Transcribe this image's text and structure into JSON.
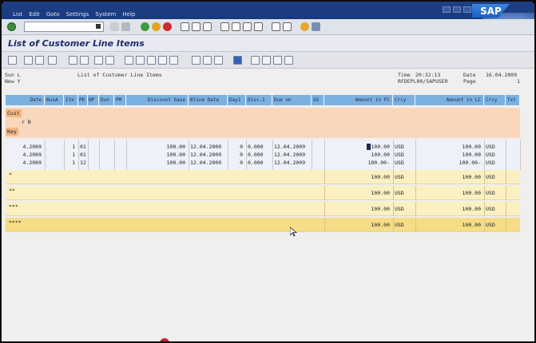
{
  "menubar": {
    "items": [
      "List",
      "Edit",
      "Goto",
      "Settings",
      "System",
      "Help"
    ],
    "logo": "SAP"
  },
  "titlebar": {
    "title": "List of Customer Line Items"
  },
  "report_header": {
    "left_line1": "Sun L",
    "left_line2": "New Y",
    "center": "List of Customer Line Items",
    "time_label": "Time",
    "time": "20:32:13",
    "date_label": "Date",
    "date": "16.04.2009",
    "program": "RFDEPL00/SAPUSER",
    "page_label": "Page",
    "page": "1"
  },
  "columns": [
    "Date",
    "BusA",
    "Ite",
    "PK",
    "NP",
    "Dun",
    "PM",
    "Discount base",
    "Bline Date",
    "Day1",
    "Disc.1",
    "Due on",
    "SG",
    "Amount in FC",
    "Crcy",
    "Amount in LC",
    "Crcy",
    "Txt"
  ],
  "group_header": {
    "line1": "Cust",
    "line2": "r B",
    "line3": "Key"
  },
  "rows": [
    {
      "date": "4.2009",
      "ite": "1",
      "pk": "01",
      "disc_base": "100.00",
      "bline": "12.04.2009",
      "day1": "0",
      "disc1": "0.000",
      "due": "12.04.2009",
      "amt_fc": "100.00",
      "crcy": "USD",
      "amt_lc": "100.00",
      "crcy2": "USD"
    },
    {
      "date": "4.2009",
      "ite": "1",
      "pk": "01",
      "disc_base": "100.00",
      "bline": "12.04.2009",
      "day1": "0",
      "disc1": "0.000",
      "due": "12.04.2009",
      "amt_fc": "100.00",
      "crcy": "USD",
      "amt_lc": "100.00",
      "crcy2": "USD"
    },
    {
      "date": "4.2009",
      "ite": "1",
      "pk": "12",
      "disc_base": "100.00",
      "bline": "12.04.2009",
      "day1": "0",
      "disc1": "0.000",
      "due": "12.04.2009",
      "amt_fc": "100.00-",
      "crcy": "USD",
      "amt_lc": "100.00-",
      "crcy2": "USD"
    }
  ],
  "totals": [
    {
      "level": "*",
      "amt_fc": "100.00",
      "crcy": "USD",
      "amt_lc": "100.00",
      "crcy2": "USD"
    },
    {
      "level": "**",
      "amt_fc": "100.00",
      "crcy": "USD",
      "amt_lc": "100.00",
      "crcy2": "USD"
    },
    {
      "level": "***",
      "amt_fc": "100.00",
      "crcy": "USD",
      "amt_lc": "100.00",
      "crcy2": "USD"
    },
    {
      "level": "****",
      "amt_fc": "100.00",
      "crcy": "USD",
      "amt_lc": "100.00",
      "crcy2": "USD"
    }
  ],
  "colors": {
    "header_blue": "#7bb1e0",
    "group_salmon": "#f8d7bd",
    "row_light": "#eef1f7",
    "total_light": "#fbf0c2",
    "total_dark": "#f5dc85",
    "title_text": "#1d2f6b"
  }
}
